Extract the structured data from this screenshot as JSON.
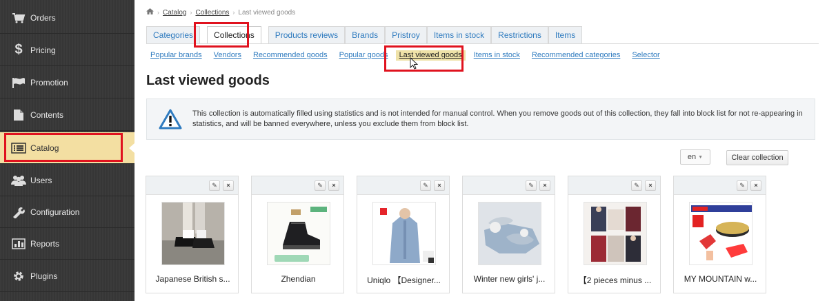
{
  "sidebar": {
    "items": [
      {
        "label": "Orders",
        "icon": "cart-icon"
      },
      {
        "label": "Pricing",
        "icon": "dollar-icon"
      },
      {
        "label": "Promotion",
        "icon": "flag-icon"
      },
      {
        "label": "Contents",
        "icon": "document-icon"
      },
      {
        "label": "Catalog",
        "icon": "list-icon",
        "active": true
      },
      {
        "label": "Users",
        "icon": "users-icon"
      },
      {
        "label": "Configuration",
        "icon": "wrench-icon"
      },
      {
        "label": "Reports",
        "icon": "chart-icon"
      },
      {
        "label": "Plugins",
        "icon": "gear-icon"
      }
    ]
  },
  "breadcrumb": {
    "home_icon": "home-icon",
    "items": [
      "Catalog",
      "Collections",
      "Last viewed goods"
    ]
  },
  "tabs": [
    "Categories",
    "Collections",
    "Products reviews",
    "Brands",
    "Pristroy",
    "Items in stock",
    "Restrictions",
    "Items"
  ],
  "active_tab": "Collections",
  "subnav": [
    "Popular brands",
    "Vendors",
    "Recommended goods",
    "Popular goods",
    "Last viewed goods",
    "Items in stock",
    "Recommended categories",
    "Selector"
  ],
  "active_subnav": "Last viewed goods",
  "page_title": "Last viewed goods",
  "notice": {
    "icon": "warning-icon",
    "text": "This collection is automatically filled using statistics and is not intended for manual control. When you remove goods out of this collection, they fall into block list for not re-appearing in statistics, and will be banned everywhere, unless you exclude them from block list."
  },
  "language": {
    "selected": "en"
  },
  "clear_label": "Clear collection",
  "products": [
    {
      "title": "Japanese British s..."
    },
    {
      "title": "Zhendian"
    },
    {
      "title": "Uniqlo 【Designer..."
    },
    {
      "title": "Winter new girls' j..."
    },
    {
      "title": "【2 pieces minus ..."
    },
    {
      "title": "MY MOUNTAIN w..."
    }
  ],
  "colors": {
    "accent_link": "#2f7bbf",
    "active_sidebar": "#f3dfa2",
    "highlight_box": "#e0121e"
  }
}
